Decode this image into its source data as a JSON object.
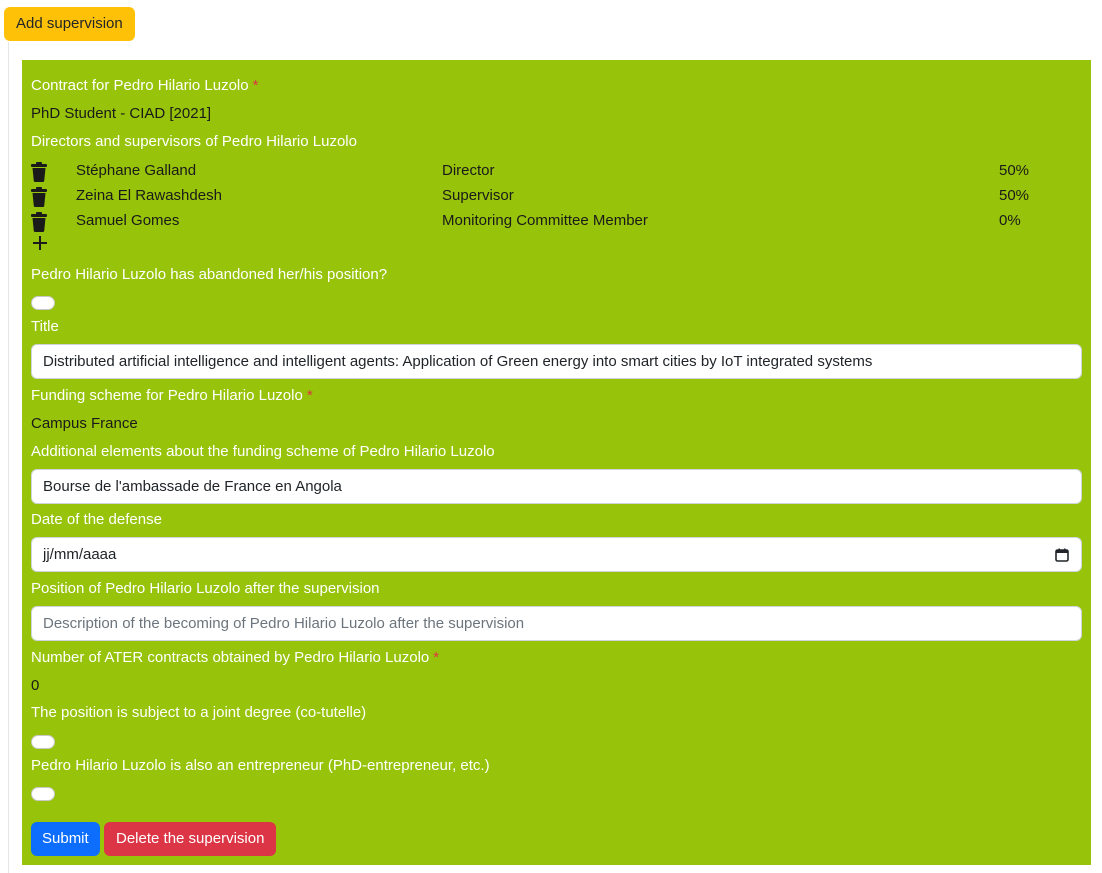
{
  "toolbar": {
    "add_label": "Add supervision"
  },
  "contract": {
    "label": "Contract for Pedro Hilario Luzolo",
    "required_mark": "*",
    "value": "PhD Student - CIAD [2021]"
  },
  "supervisors": {
    "label": "Directors and supervisors of Pedro Hilario Luzolo",
    "rows": [
      {
        "name": "Stéphane Galland",
        "role": "Director",
        "percent": "50%"
      },
      {
        "name": "Zeina El Rawashdesh",
        "role": "Supervisor",
        "percent": "50%"
      },
      {
        "name": "Samuel Gomes",
        "role": "Monitoring Committee Member",
        "percent": "0%"
      }
    ],
    "icons": {
      "delete": "trash-icon",
      "add": "plus-icon"
    }
  },
  "abandoned": {
    "label": "Pedro Hilario Luzolo has abandoned her/his position?",
    "checked": false
  },
  "title": {
    "label": "Title",
    "value": "Distributed artificial intelligence and intelligent agents: Application of Green energy into smart cities by IoT integrated systems"
  },
  "funding": {
    "label": "Funding scheme for Pedro Hilario Luzolo",
    "required_mark": "*",
    "value": "Campus France"
  },
  "funding_details": {
    "label": "Additional elements about the funding scheme of Pedro Hilario Luzolo",
    "value": "Bourse de l'ambassade de France en Angola"
  },
  "defense_date": {
    "label": "Date of the defense",
    "value": "jj/mm/aaaa",
    "icon": "calendar-icon"
  },
  "position_after": {
    "label": "Position of Pedro Hilario Luzolo after the supervision",
    "placeholder": "Description of the becoming of Pedro Hilario Luzolo after the supervision"
  },
  "ater": {
    "label": "Number of ATER contracts obtained by Pedro Hilario Luzolo",
    "required_mark": "*",
    "value": "0"
  },
  "joint_degree": {
    "label": "The position is subject to a joint degree (co-tutelle)",
    "checked": false
  },
  "entrepreneur": {
    "label": "Pedro Hilario Luzolo is also an entrepreneur (PhD-entrepreneur, etc.)",
    "checked": false
  },
  "actions": {
    "submit_label": "Submit",
    "delete_label": "Delete the supervision"
  },
  "colors": {
    "panel_bg": "#97c30a",
    "add_button": "#ffc107",
    "submit_button": "#0d6efd",
    "delete_button": "#dc3545",
    "required": "#dc3545"
  }
}
